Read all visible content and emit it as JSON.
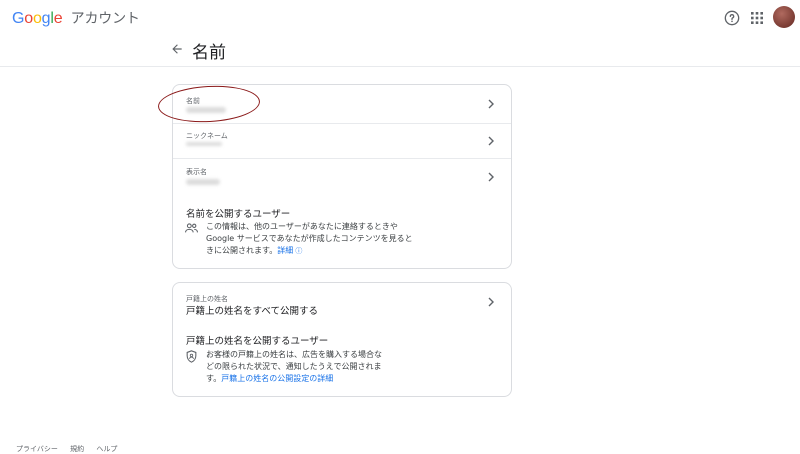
{
  "header": {
    "logo_letters": [
      "G",
      "o",
      "o",
      "g",
      "l",
      "e"
    ],
    "product": "アカウント",
    "page_title": "名前"
  },
  "card1": {
    "rows": [
      {
        "label": "名前"
      },
      {
        "label": "ニックネーム"
      },
      {
        "label": "表示名"
      }
    ],
    "section_title": "名前を公開するユーザー",
    "description_lines": [
      "この情報は、他のユーザーがあなたに連絡するときや",
      "Google サービスであなたが作成したコンテンツを見ると",
      "きに公開されます。"
    ],
    "link": "詳細"
  },
  "card2": {
    "label": "戸籍上の姓名",
    "value": "戸籍上の姓名をすべて公開する",
    "section_title": "戸籍上の姓名を公開するユーザー",
    "description_lines": [
      "お客様の戸籍上の姓名は、広告を購入する場合な",
      "どの限られた状況で、通知したうえで公開されま",
      "す。"
    ],
    "link": "戸籍上の姓名の公開設定の詳細"
  },
  "footer": {
    "items": [
      "プライバシー",
      "規約",
      "ヘルプ"
    ]
  },
  "colors": {
    "accent": "#1a73e8",
    "annotation": "#8b1a1a"
  }
}
